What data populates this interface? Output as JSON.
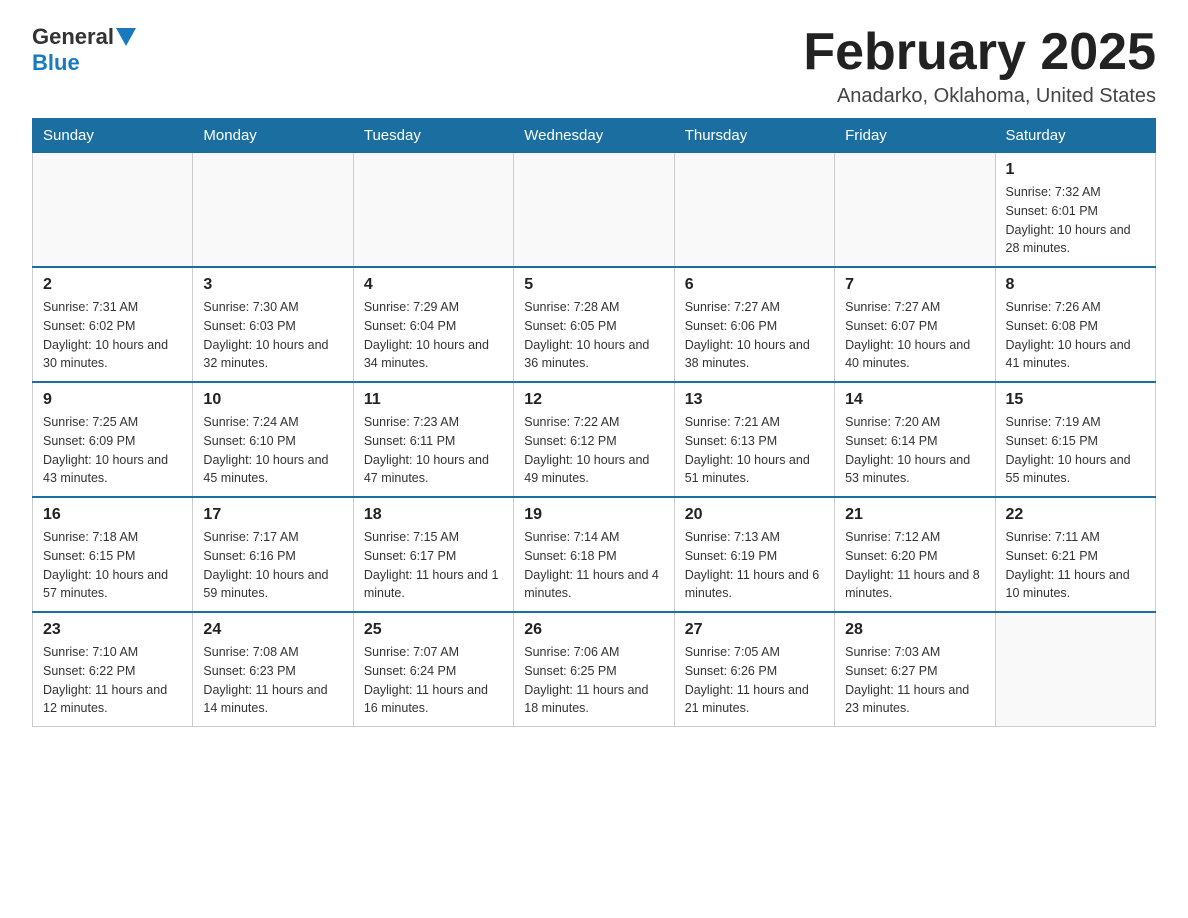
{
  "header": {
    "logo": {
      "general": "General",
      "blue": "Blue"
    },
    "title": "February 2025",
    "location": "Anadarko, Oklahoma, United States"
  },
  "days_of_week": [
    "Sunday",
    "Monday",
    "Tuesday",
    "Wednesday",
    "Thursday",
    "Friday",
    "Saturday"
  ],
  "weeks": [
    [
      {
        "day": null
      },
      {
        "day": null
      },
      {
        "day": null
      },
      {
        "day": null
      },
      {
        "day": null
      },
      {
        "day": null
      },
      {
        "day": 1,
        "sunrise": "7:32 AM",
        "sunset": "6:01 PM",
        "daylight": "10 hours and 28 minutes."
      }
    ],
    [
      {
        "day": 2,
        "sunrise": "7:31 AM",
        "sunset": "6:02 PM",
        "daylight": "10 hours and 30 minutes."
      },
      {
        "day": 3,
        "sunrise": "7:30 AM",
        "sunset": "6:03 PM",
        "daylight": "10 hours and 32 minutes."
      },
      {
        "day": 4,
        "sunrise": "7:29 AM",
        "sunset": "6:04 PM",
        "daylight": "10 hours and 34 minutes."
      },
      {
        "day": 5,
        "sunrise": "7:28 AM",
        "sunset": "6:05 PM",
        "daylight": "10 hours and 36 minutes."
      },
      {
        "day": 6,
        "sunrise": "7:27 AM",
        "sunset": "6:06 PM",
        "daylight": "10 hours and 38 minutes."
      },
      {
        "day": 7,
        "sunrise": "7:27 AM",
        "sunset": "6:07 PM",
        "daylight": "10 hours and 40 minutes."
      },
      {
        "day": 8,
        "sunrise": "7:26 AM",
        "sunset": "6:08 PM",
        "daylight": "10 hours and 41 minutes."
      }
    ],
    [
      {
        "day": 9,
        "sunrise": "7:25 AM",
        "sunset": "6:09 PM",
        "daylight": "10 hours and 43 minutes."
      },
      {
        "day": 10,
        "sunrise": "7:24 AM",
        "sunset": "6:10 PM",
        "daylight": "10 hours and 45 minutes."
      },
      {
        "day": 11,
        "sunrise": "7:23 AM",
        "sunset": "6:11 PM",
        "daylight": "10 hours and 47 minutes."
      },
      {
        "day": 12,
        "sunrise": "7:22 AM",
        "sunset": "6:12 PM",
        "daylight": "10 hours and 49 minutes."
      },
      {
        "day": 13,
        "sunrise": "7:21 AM",
        "sunset": "6:13 PM",
        "daylight": "10 hours and 51 minutes."
      },
      {
        "day": 14,
        "sunrise": "7:20 AM",
        "sunset": "6:14 PM",
        "daylight": "10 hours and 53 minutes."
      },
      {
        "day": 15,
        "sunrise": "7:19 AM",
        "sunset": "6:15 PM",
        "daylight": "10 hours and 55 minutes."
      }
    ],
    [
      {
        "day": 16,
        "sunrise": "7:18 AM",
        "sunset": "6:15 PM",
        "daylight": "10 hours and 57 minutes."
      },
      {
        "day": 17,
        "sunrise": "7:17 AM",
        "sunset": "6:16 PM",
        "daylight": "10 hours and 59 minutes."
      },
      {
        "day": 18,
        "sunrise": "7:15 AM",
        "sunset": "6:17 PM",
        "daylight": "11 hours and 1 minute."
      },
      {
        "day": 19,
        "sunrise": "7:14 AM",
        "sunset": "6:18 PM",
        "daylight": "11 hours and 4 minutes."
      },
      {
        "day": 20,
        "sunrise": "7:13 AM",
        "sunset": "6:19 PM",
        "daylight": "11 hours and 6 minutes."
      },
      {
        "day": 21,
        "sunrise": "7:12 AM",
        "sunset": "6:20 PM",
        "daylight": "11 hours and 8 minutes."
      },
      {
        "day": 22,
        "sunrise": "7:11 AM",
        "sunset": "6:21 PM",
        "daylight": "11 hours and 10 minutes."
      }
    ],
    [
      {
        "day": 23,
        "sunrise": "7:10 AM",
        "sunset": "6:22 PM",
        "daylight": "11 hours and 12 minutes."
      },
      {
        "day": 24,
        "sunrise": "7:08 AM",
        "sunset": "6:23 PM",
        "daylight": "11 hours and 14 minutes."
      },
      {
        "day": 25,
        "sunrise": "7:07 AM",
        "sunset": "6:24 PM",
        "daylight": "11 hours and 16 minutes."
      },
      {
        "day": 26,
        "sunrise": "7:06 AM",
        "sunset": "6:25 PM",
        "daylight": "11 hours and 18 minutes."
      },
      {
        "day": 27,
        "sunrise": "7:05 AM",
        "sunset": "6:26 PM",
        "daylight": "11 hours and 21 minutes."
      },
      {
        "day": 28,
        "sunrise": "7:03 AM",
        "sunset": "6:27 PM",
        "daylight": "11 hours and 23 minutes."
      },
      {
        "day": null
      }
    ]
  ]
}
